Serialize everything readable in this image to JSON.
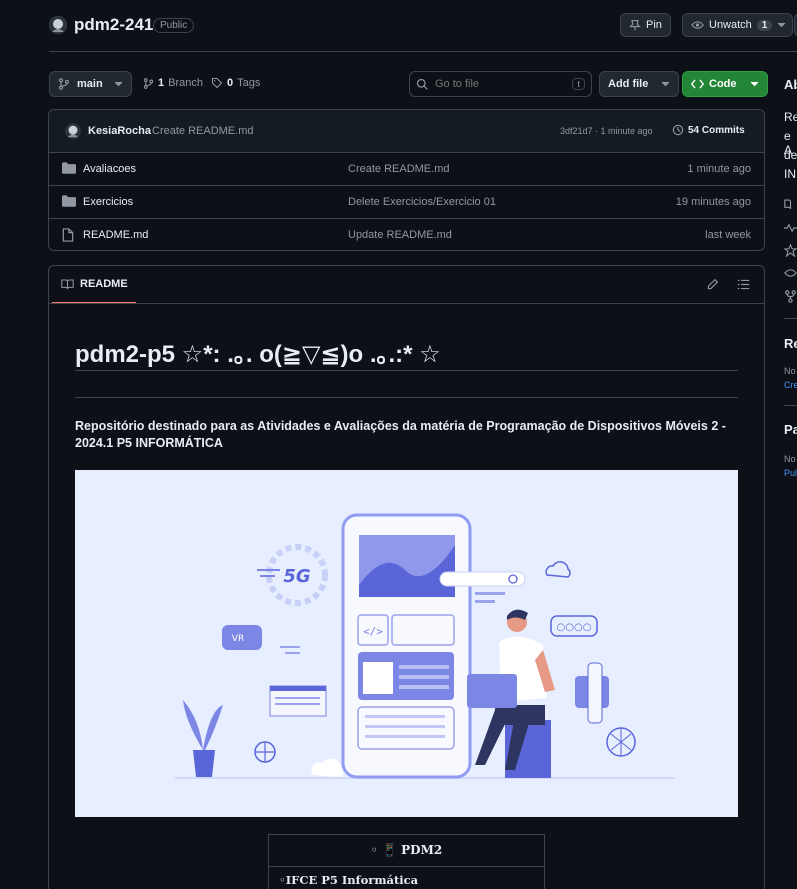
{
  "repo": {
    "name": "pdm2-241",
    "visibility": "Public"
  },
  "header_actions": {
    "pin_label": "Pin",
    "unwatch_label": "Unwatch",
    "watch_count": "1"
  },
  "toolbar": {
    "branch": "main",
    "branches_count": "1",
    "branches_label": "Branch",
    "tags_count": "0",
    "tags_label": "Tags",
    "search_placeholder": "Go to file",
    "search_shortcut": "t",
    "add_file_label": "Add file",
    "code_label": "Code"
  },
  "last_commit": {
    "author": "KesiaRocha",
    "message": "Create README.md",
    "hash_time": "3df21d7 · 1 minute ago",
    "commits_label": "54 Commits"
  },
  "files": [
    {
      "name": "Avaliacoes",
      "type": "folder",
      "message": "Create README.md",
      "age": "1 minute ago"
    },
    {
      "name": "Exercicios",
      "type": "folder",
      "message": "Delete Exercicios/Exercicio 01",
      "age": "19 minutes ago"
    },
    {
      "name": "README.md",
      "type": "file",
      "message": "Update README.md",
      "age": "last week"
    }
  ],
  "readme": {
    "tab_label": "README",
    "title": "pdm2-p5 ☆*: .｡. o(≧▽≦)o .｡.:* ☆",
    "description": "Repositório destinado para as Atividades e Avaliações da matéria de Programação de Dispositivos Móveis 2 - 2024.1 P5 INFORMÁTICA",
    "table_header": "◦ 📱 PDM2",
    "table_row": "◦IFCE P5 Informática"
  },
  "sidebar": {
    "about_title": "Ab",
    "about_lines": [
      "Re",
      "e A",
      "de",
      "IN"
    ],
    "releases_title": "Re",
    "releases_text": "No",
    "releases_link": "Cre",
    "packages_title": "Pa",
    "packages_text": "No",
    "packages_link": "Pul"
  },
  "colors": {
    "bg": "#0d1117",
    "border": "#3d444d",
    "accent_green": "#238636",
    "link": "#4493f8",
    "illustration_bg": "#e7eeff"
  }
}
